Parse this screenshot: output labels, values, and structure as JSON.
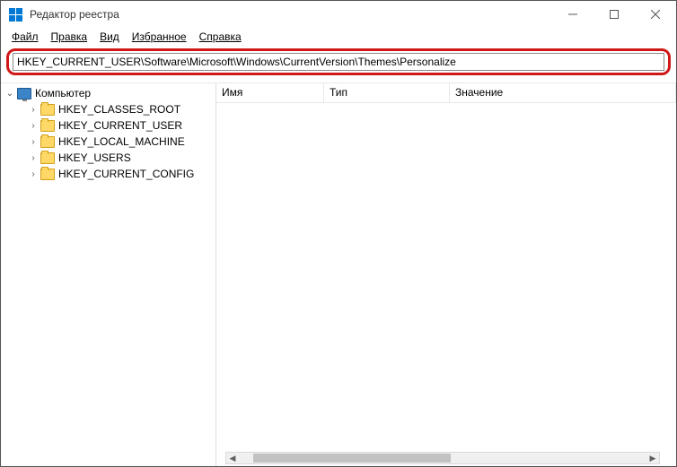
{
  "window": {
    "title": "Редактор реестра"
  },
  "menu": {
    "file": "Файл",
    "edit": "Правка",
    "view": "Вид",
    "favorites": "Избранное",
    "help": "Справка"
  },
  "address": "HKEY_CURRENT_USER\\Software\\Microsoft\\Windows\\CurrentVersion\\Themes\\Personalize",
  "tree": {
    "root": "Компьютер",
    "hives": [
      "HKEY_CLASSES_ROOT",
      "HKEY_CURRENT_USER",
      "HKEY_LOCAL_MACHINE",
      "HKEY_USERS",
      "HKEY_CURRENT_CONFIG"
    ]
  },
  "columns": {
    "name": "Имя",
    "type": "Тип",
    "value": "Значение"
  }
}
